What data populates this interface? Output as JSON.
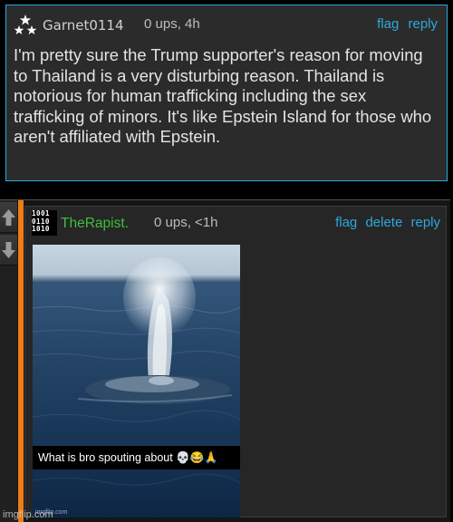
{
  "parent_comment": {
    "username": "Garnet0114",
    "meta": "0 ups, 4h",
    "actions": {
      "flag": "flag",
      "reply": "reply"
    },
    "body": "I'm pretty sure the Trump supporter's reason for moving to Thailand is a very disturbing reason. Thailand is notorious for human trafficking including the sex trafficking of minors. It's like Epstein Island for those who aren't affiliated with Epstein."
  },
  "reply_comment": {
    "username": "TheRapist.",
    "avatar_code": [
      "1001",
      "0110",
      "1010"
    ],
    "meta": "0 ups, <1h",
    "actions": {
      "flag": "flag",
      "delete": "delete",
      "reply": "reply"
    },
    "meme": {
      "caption": "What is bro spouting about 💀😂🙏",
      "watermark": "imgflip.com"
    }
  },
  "site_watermark": "imgflip.com",
  "colors": {
    "link": "#2aa9dc",
    "username_reply": "#3fbf3f",
    "reply_bar": "#ee7d16",
    "panel_border": "#2aa9dc"
  },
  "icons": {
    "upvote": "up-arrow-icon",
    "downvote": "down-arrow-icon"
  }
}
